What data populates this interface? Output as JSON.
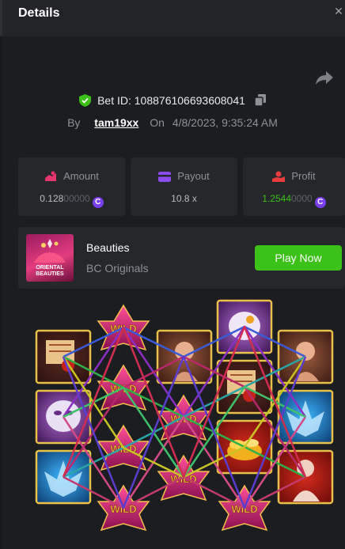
{
  "header": {
    "title": "Details",
    "close_icon": "close-icon"
  },
  "bet": {
    "id_label": "Bet ID:",
    "id_value": "108876106693608041",
    "by_label": "By",
    "user": "tam19xx",
    "on_label": "On",
    "datetime": "4/8/2023, 9:35:24 AM"
  },
  "stats": {
    "amount": {
      "label": "Amount",
      "value_main": "0.128",
      "value_dim": "00000",
      "coin": "C"
    },
    "payout": {
      "label": "Payout",
      "value": "10.8 x"
    },
    "profit": {
      "label": "Profit",
      "value_main": "1.2544",
      "value_dim": "0000",
      "coin": "C"
    }
  },
  "game": {
    "name": "Beauties",
    "provider": "BC Originals",
    "thumb_text": "ORIENTAL BEAUTIES",
    "play_label": "Play Now"
  },
  "symbols": {
    "wild_text": "WILD"
  },
  "colors": {
    "accent_green": "#3bc117",
    "coin_purple": "#7b3ff2",
    "amount_icon": "#e6366d",
    "payout_icon": "#8b4bf0",
    "profit_icon": "#e63c3c",
    "frame_gold": "#e8c04a"
  }
}
